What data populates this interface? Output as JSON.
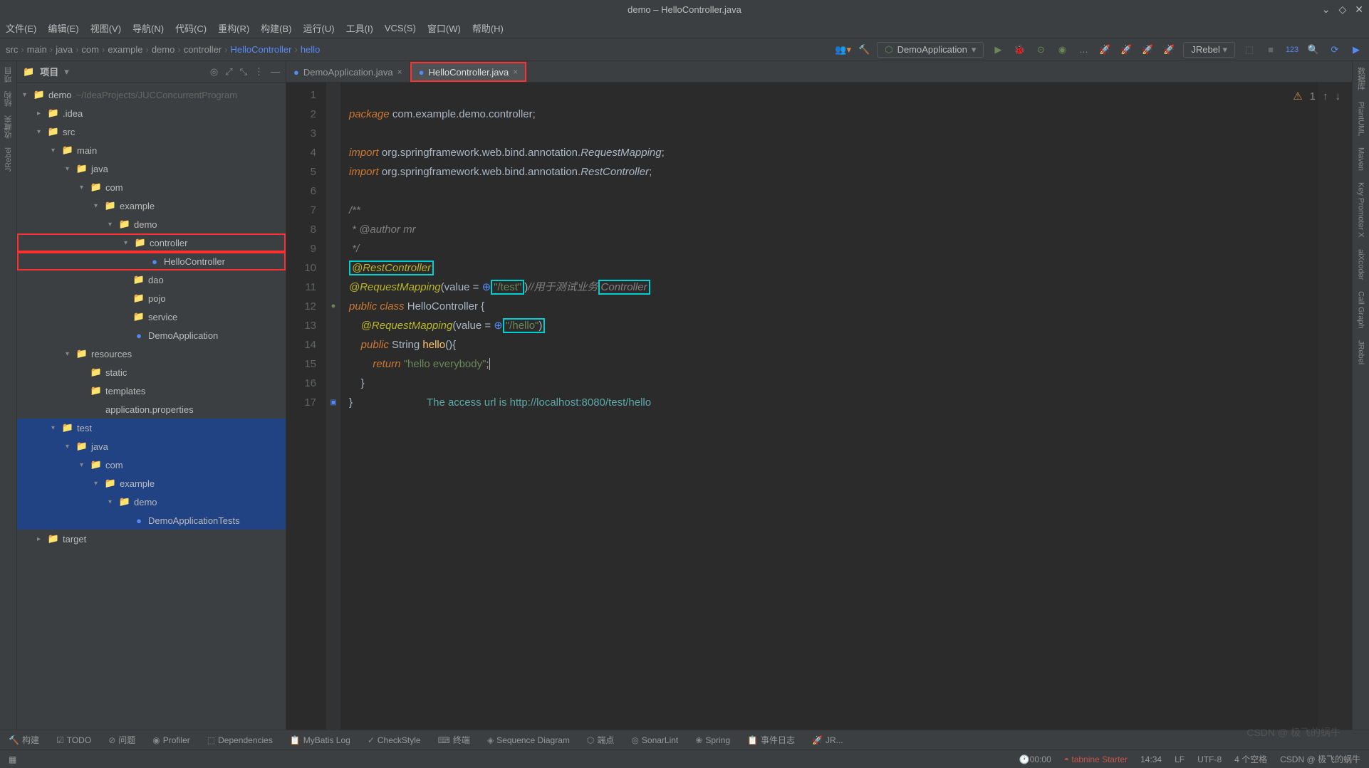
{
  "titlebar": {
    "text": "demo – HelloController.java"
  },
  "menubar": [
    "文件(E)",
    "编辑(E)",
    "视图(V)",
    "导航(N)",
    "代码(C)",
    "重构(R)",
    "构建(B)",
    "运行(U)",
    "工具(I)",
    "VCS(S)",
    "窗口(W)",
    "帮助(H)"
  ],
  "breadcrumb": [
    "src",
    "main",
    "java",
    "com",
    "example",
    "demo",
    "controller",
    "HelloController",
    "hello"
  ],
  "run_config": "DemoApplication",
  "jrebel": "JRebel",
  "sidebar": {
    "title": "项目",
    "root": {
      "name": "demo",
      "path": "~/IdeaProjects/JUCConcurrentProgram"
    },
    "rows": [
      {
        "indent": 0,
        "arrow": "▾",
        "icon": "📁",
        "color": "#d28b4b",
        "label": "demo",
        "path": "~/IdeaProjects/JUCConcurrentProgram"
      },
      {
        "indent": 1,
        "arrow": "▸",
        "icon": "📁",
        "color": "#548af7",
        "label": ".idea"
      },
      {
        "indent": 1,
        "arrow": "▾",
        "icon": "📁",
        "color": "#548af7",
        "label": "src"
      },
      {
        "indent": 2,
        "arrow": "▾",
        "icon": "📁",
        "color": "#999",
        "label": "main"
      },
      {
        "indent": 3,
        "arrow": "▾",
        "icon": "📁",
        "color": "#9876aa",
        "label": "java"
      },
      {
        "indent": 4,
        "arrow": "▾",
        "icon": "📁",
        "color": "#999",
        "label": "com"
      },
      {
        "indent": 5,
        "arrow": "▾",
        "icon": "📁",
        "color": "#9876aa",
        "label": "example"
      },
      {
        "indent": 6,
        "arrow": "▾",
        "icon": "📁",
        "color": "#999",
        "label": "demo"
      },
      {
        "indent": 7,
        "arrow": "▾",
        "icon": "📁",
        "color": "#9876aa",
        "label": "controller",
        "hl": true
      },
      {
        "indent": 8,
        "arrow": "",
        "icon": "●",
        "color": "#548af7",
        "label": "HelloController",
        "hl": true
      },
      {
        "indent": 7,
        "arrow": "",
        "icon": "📁",
        "color": "#d28b4b",
        "label": "dao"
      },
      {
        "indent": 7,
        "arrow": "",
        "icon": "📁",
        "color": "#d28b4b",
        "label": "pojo"
      },
      {
        "indent": 7,
        "arrow": "",
        "icon": "📁",
        "color": "#548af7",
        "label": "service"
      },
      {
        "indent": 7,
        "arrow": "",
        "icon": "●",
        "color": "#548af7",
        "label": "DemoApplication"
      },
      {
        "indent": 3,
        "arrow": "▾",
        "icon": "📁",
        "color": "#9876aa",
        "label": "resources"
      },
      {
        "indent": 4,
        "arrow": "",
        "icon": "📁",
        "color": "#548af7",
        "label": "static"
      },
      {
        "indent": 4,
        "arrow": "",
        "icon": "📁",
        "color": "#d28b4b",
        "label": "templates"
      },
      {
        "indent": 4,
        "arrow": "",
        "icon": "</>",
        "color": "#999",
        "label": "application.properties"
      },
      {
        "indent": 2,
        "arrow": "▾",
        "icon": "📁",
        "color": "#6a8759",
        "label": "test",
        "test": true
      },
      {
        "indent": 3,
        "arrow": "▾",
        "icon": "📁",
        "color": "#9876aa",
        "label": "java",
        "test": true
      },
      {
        "indent": 4,
        "arrow": "▾",
        "icon": "📁",
        "color": "#d28b4b",
        "label": "com",
        "test": true
      },
      {
        "indent": 5,
        "arrow": "▾",
        "icon": "📁",
        "color": "#9876aa",
        "label": "example",
        "test": true
      },
      {
        "indent": 6,
        "arrow": "▾",
        "icon": "📁",
        "color": "#d28b4b",
        "label": "demo",
        "test": true
      },
      {
        "indent": 7,
        "arrow": "",
        "icon": "●",
        "color": "#548af7",
        "label": "DemoApplicationTests",
        "test": true
      },
      {
        "indent": 1,
        "arrow": "▸",
        "icon": "📁",
        "color": "#d28b4b",
        "label": "target"
      }
    ]
  },
  "tabs": [
    {
      "label": "DemoApplication.java",
      "active": false
    },
    {
      "label": "HelloController.java",
      "active": true,
      "hl": true
    }
  ],
  "editor_warn": "1",
  "code_lines": [
    "1",
    "2",
    "3",
    "4",
    "5",
    "6",
    "7",
    "8",
    "9",
    "10",
    "11",
    "12",
    "13",
    "14",
    "15",
    "16",
    "17"
  ],
  "code": {
    "pkg": "package",
    "pkgname": "com.example.demo.controller",
    "imp": "import",
    "imp1": "org.springframework.web.bind.annotation.",
    "imp1c": "RequestMapping",
    "imp2c": "RestController",
    "restc": "@RestController",
    "reqm": "@RequestMapping",
    "val": "value = ",
    "test": "\"/test\"",
    "testcmt": "//用于测试业务",
    "testcmt2": "Controller",
    "pub": "public",
    "cls": "class",
    "clsname": "HelloController",
    "hello": "\"/hello\"",
    "str": "String",
    "fn": "hello",
    "ret": "return",
    "retval": "\"hello everybody\"",
    "hint": "The access url is http://localhost:8080/test/hello",
    "author": "@author",
    "authorname": "mr"
  },
  "bottom": [
    "构建",
    "TODO",
    "问题",
    "Profiler",
    "Dependencies",
    "MyBatis Log",
    "CheckStyle",
    "终端",
    "Sequence Diagram",
    "端点",
    "SonarLint",
    "Spring",
    "事件日志",
    "JR..."
  ],
  "status": {
    "time_emoji": "🕐00:00",
    "tabnine": "tabnine Starter",
    "pos": "14:34",
    "le": "LF",
    "enc": "UTF-8",
    "spaces": "4 个空格",
    "branch": "CSDN @ 极飞的蜗牛"
  },
  "left_tools": [
    "项目",
    "结构",
    "收藏夹",
    "JRebel"
  ],
  "right_tools": [
    "数据库",
    "PlantUML",
    "Maven",
    "Key Promoter X",
    "aiXcoder",
    "Call Graph",
    "JRebel"
  ]
}
